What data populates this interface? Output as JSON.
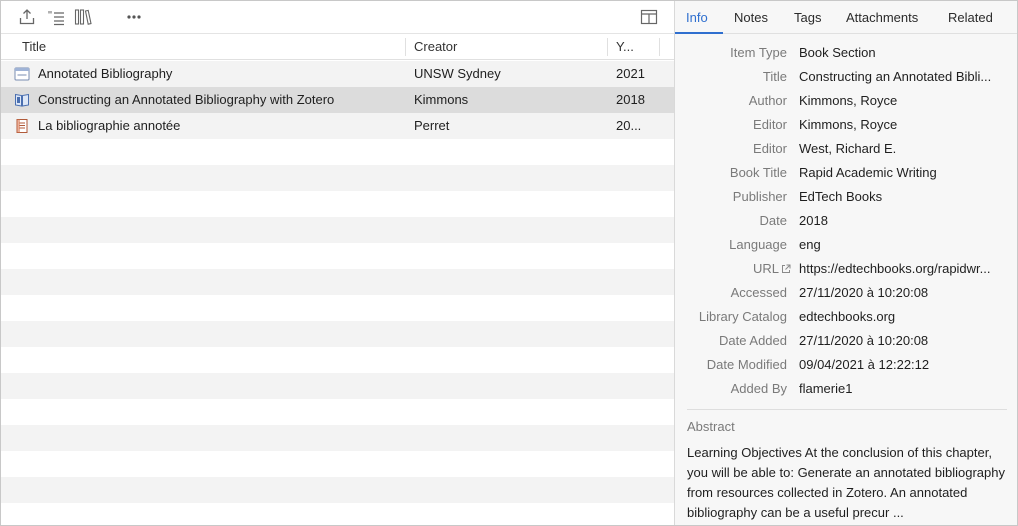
{
  "toolbar": {
    "icons": [
      "export-icon",
      "sort-list-icon",
      "library-icon",
      "more-icon",
      "layout-icon"
    ]
  },
  "columns": {
    "title": "Title",
    "creator": "Creator",
    "year": "Y..."
  },
  "items": [
    {
      "icon": "webpage-icon",
      "title": "Annotated Bibliography",
      "creator": "UNSW Sydney",
      "year": "2021"
    },
    {
      "icon": "book-section-icon",
      "title": "Constructing an Annotated Bibliography with Zotero",
      "creator": "Kimmons",
      "year": "2018"
    },
    {
      "icon": "document-icon",
      "title": "La bibliographie annotée",
      "creator": "Perret",
      "year": "20..."
    }
  ],
  "tabs": [
    "Info",
    "Notes",
    "Tags",
    "Attachments",
    "Related"
  ],
  "active_tab": "Info",
  "info": {
    "fields": [
      {
        "label": "Item Type",
        "value": "Book Section"
      },
      {
        "label": "Title",
        "value": "Constructing an Annotated Bibli..."
      },
      {
        "label": "Author",
        "value": "Kimmons, Royce"
      },
      {
        "label": "Editor",
        "value": "Kimmons, Royce"
      },
      {
        "label": "Editor",
        "value": "West, Richard E."
      },
      {
        "label": "Book Title",
        "value": "Rapid Academic Writing"
      },
      {
        "label": "Publisher",
        "value": "EdTech Books"
      },
      {
        "label": "Date",
        "value": "2018"
      },
      {
        "label": "Language",
        "value": "eng"
      },
      {
        "label": "URL",
        "value": "https://edtechbooks.org/rapidwr..."
      },
      {
        "label": "Accessed",
        "value": "27/11/2020 à 10:20:08"
      },
      {
        "label": "Library Catalog",
        "value": "edtechbooks.org"
      },
      {
        "label": "Date Added",
        "value": "27/11/2020 à 10:20:08"
      },
      {
        "label": "Date Modified",
        "value": "09/04/2021 à 12:22:12"
      },
      {
        "label": "Added By",
        "value": "flamerie1"
      }
    ],
    "abstract_label": "Abstract",
    "abstract": "Learning Objectives At the conclusion of this chapter, you will be able to: Generate an annotated bibliography from resources collected in Zotero. An annotated bibliography can be a useful precur ..."
  },
  "colors": {
    "accent": "#2f6fcf",
    "selected_row": "#dcdcdc",
    "alt_row": "#f3f3f3",
    "pane_bg": "#f7f7f7"
  }
}
